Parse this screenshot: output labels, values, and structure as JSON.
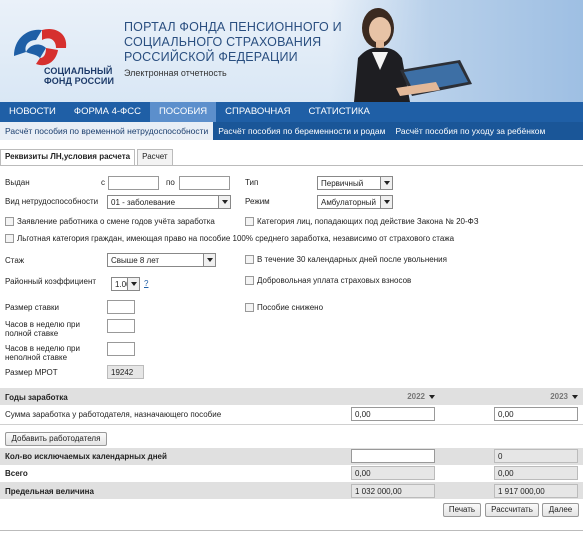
{
  "header": {
    "logo_text_line1": "СОЦИАЛЬНЫЙ",
    "logo_text_line2": "ФОНД РОССИИ",
    "title_line1": "ПОРТАЛ ФОНДА ПЕНСИОННОГО И",
    "title_line2": "СОЦИАЛЬНОГО СТРАХОВАНИЯ",
    "title_line3": "РОССИЙСКОЙ ФЕДЕРАЦИИ",
    "subtitle": "Электронная отчетность"
  },
  "mainnav": {
    "items": [
      "НОВОСТИ",
      "ФОРМА 4-ФСС",
      "ПОСОБИЯ",
      "СПРАВОЧНАЯ",
      "СТАТИСТИКА"
    ],
    "active": "ПОСОБИЯ"
  },
  "subnav": {
    "items": [
      "Расчёт пособия по временной нетрудоспособности",
      "Расчёт пособия по беременности и родам",
      "Расчёт пособия по уходу за ребёнком"
    ]
  },
  "tabs": [
    "Реквизиты ЛН,условия расчета",
    "Расчет"
  ],
  "form": {
    "issued_label": "Выдан",
    "from_label": "с",
    "to_label": "по",
    "type_label": "Тип",
    "type_value": "Первичный",
    "disability_type_label": "Вид нетрудоспособности",
    "disability_type_value": "01 - заболевание",
    "mode_label": "Режим",
    "mode_value": "Амбулаторный",
    "chk_years_change": "Заявление работника о смене годов учёта заработка",
    "chk_law_category": "Категория лиц, попадающих под действие Закона № 20-ФЗ",
    "chk_privileged": "Льготная категория граждан, имеющая право на пособие 100% среднего заработка, независимо от страхового стажа",
    "experience_label": "Стаж",
    "experience_value": "Свыше 8 лет",
    "chk_30days": "В течение 30 календарных дней после увольнения",
    "regional_coef_label": "Районный коэффициент",
    "regional_coef_value": "1.00",
    "regional_coef_link": "?",
    "chk_voluntary": "Добровольная уплата страховых взносов",
    "rate_label": "Размер ставки",
    "chk_reduced": "Пособие снижено",
    "hours_full_label_1": "Часов в неделю при",
    "hours_full_label_2": "полной ставке",
    "hours_part_label_1": "Часов в неделю при",
    "hours_part_label_2": "неполной ставке",
    "mrot_label": "Размер МРОТ",
    "mrot_value": "19242"
  },
  "earnings": {
    "years_label": "Годы заработка",
    "year1": "2022",
    "year2": "2023",
    "sum_label": "Сумма заработка у работодателя, назначающего пособие",
    "sum1": "0,00",
    "sum2": "0,00",
    "add_employer_button": "Добавить работодателя",
    "excluded_days_label": "Кол-во исключаемых календарных дней",
    "excluded_days_value": "0",
    "total_label": "Всего",
    "total1": "0,00",
    "total2": "0,00",
    "limit_label": "Предельная величина",
    "limit1": "1 032 000,00",
    "limit2": "1 917 000,00"
  },
  "buttons": {
    "print": "Печать",
    "calculate": "Рассчитать",
    "next": "Далее"
  },
  "colors": {
    "nav_bg": "#1f5fa6",
    "nav_active": "#5c8fcc",
    "logo_blue": "#1f5fa6",
    "logo_red": "#d6302e"
  }
}
